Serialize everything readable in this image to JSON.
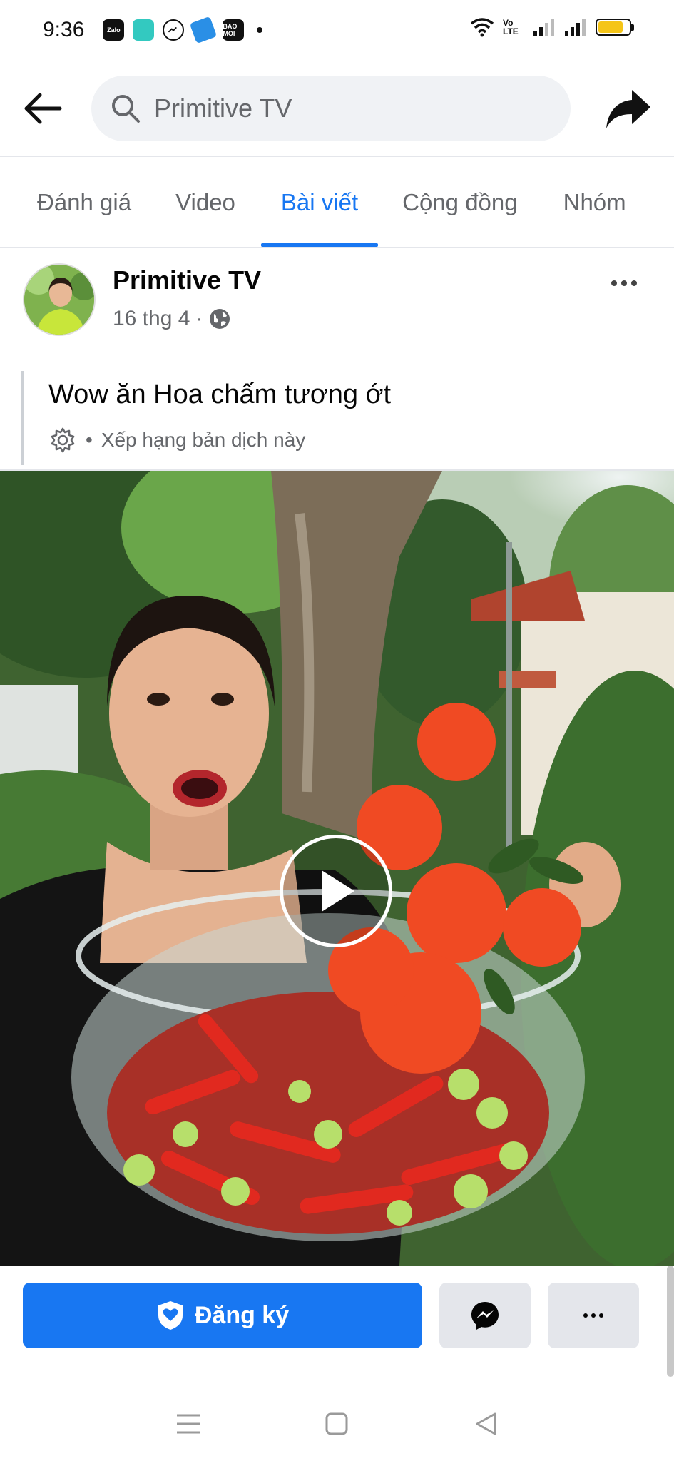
{
  "status_bar": {
    "time": "9:36",
    "apps": [
      "Zalo",
      "",
      "",
      "",
      "BAO MOI"
    ],
    "volte": "Vo LTE",
    "battery_level": 0.8
  },
  "search": {
    "value": "Primitive TV"
  },
  "tabs": [
    {
      "label": "Đánh giá",
      "active": false
    },
    {
      "label": "Video",
      "active": false
    },
    {
      "label": "Bài viết",
      "active": true
    },
    {
      "label": "Cộng đồng",
      "active": false
    },
    {
      "label": "Nhóm",
      "active": false
    }
  ],
  "post": {
    "author": "Primitive TV",
    "date": "16 thg 4",
    "separator": "·",
    "text": "Wow ăn Hoa chấm tương ớt",
    "translate_separator": "•",
    "translate_label": "Xếp hạng bản dịch này"
  },
  "actions": {
    "subscribe_label": "Đăng ký"
  },
  "colors": {
    "accent": "#1877f2",
    "muted": "#65676b",
    "button_bg": "#e4e6eb"
  }
}
